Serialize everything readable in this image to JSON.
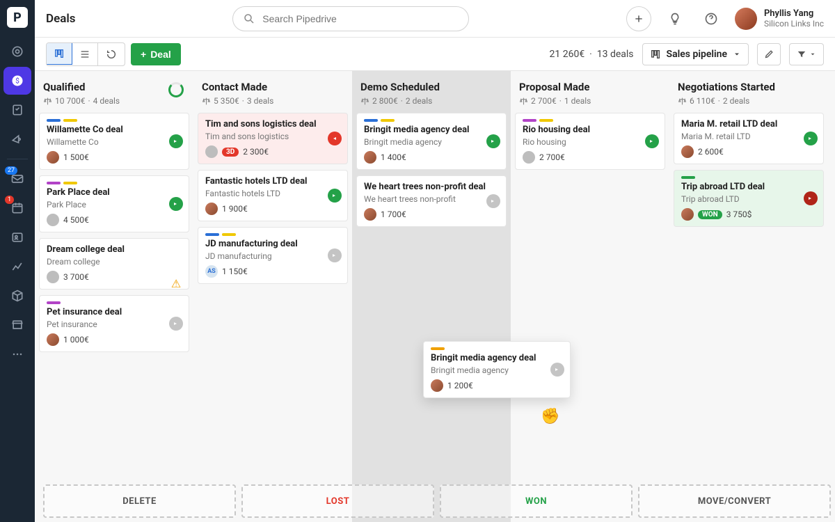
{
  "page_title": "Deals",
  "search_placeholder": "Search Pipedrive",
  "user": {
    "name": "Phyllis Yang",
    "org": "Silicon Links Inc"
  },
  "nav_badges": {
    "mail": "27",
    "calendar": "1"
  },
  "toolbar": {
    "deal_btn": "Deal",
    "summary_value": "21 260€",
    "summary_count": "13 deals",
    "pipeline_label": "Sales pipeline"
  },
  "columns": [
    {
      "title": "Qualified",
      "value": "10 700€",
      "count": "4 deals",
      "ring": true,
      "cards": [
        {
          "stripes": [
            "#2a6fd6",
            "#f0c800"
          ],
          "title": "Willamette Co deal",
          "org": "Willamette Co",
          "amount": "1 500€",
          "status": "green",
          "avatar": "photo"
        },
        {
          "stripes": [
            "#b243c7",
            "#f0c800"
          ],
          "title": "Park Place deal",
          "org": "Park Place",
          "amount": "4 500€",
          "status": "green",
          "avatar": "grey"
        },
        {
          "stripes": [],
          "title": "Dream college deal",
          "org": "Dream college",
          "amount": "3 700€",
          "status": "warn",
          "avatar": "grey"
        },
        {
          "stripes": [
            "#b243c7"
          ],
          "title": "Pet insurance deal",
          "org": "Pet insurance",
          "amount": "1 000€",
          "status": "grey",
          "avatar": "photo"
        }
      ]
    },
    {
      "title": "Contact Made",
      "value": "5 350€",
      "count": "3 deals",
      "cards": [
        {
          "stripes": [],
          "title": "Tim and sons logistics deal",
          "org": "Tim and sons logistics",
          "amount": "2 300€",
          "status": "red",
          "avatar": "grey",
          "pill": "3D",
          "bg": "red"
        },
        {
          "stripes": [],
          "title": "Fantastic hotels LTD deal",
          "org": "Fantastic hotels LTD",
          "amount": "1 900€",
          "status": "green",
          "avatar": "photo"
        },
        {
          "stripes": [
            "#2a6fd6",
            "#f0c800"
          ],
          "title": "JD manufacturing deal",
          "org": "JD manufacturing",
          "amount": "1 150€",
          "status": "grey",
          "avatar": "initials",
          "initials": "AS"
        }
      ]
    },
    {
      "title": "Demo Scheduled",
      "value": "2 800€",
      "count": "2 deals",
      "dragging": true,
      "cards": [
        {
          "stripes": [
            "#2a6fd6",
            "#f0c800"
          ],
          "title": "Bringit media agency deal",
          "org": "Bringit media agency",
          "amount": "1 400€",
          "status": "green",
          "avatar": "photo"
        },
        {
          "stripes": [],
          "title": "We heart trees non-profit deal",
          "org": "We heart trees non-profit",
          "amount": "1 700€",
          "status": "grey",
          "avatar": "photo"
        }
      ]
    },
    {
      "title": "Proposal Made",
      "value": "2 700€",
      "count": "1 deals",
      "cards": [
        {
          "stripes": [
            "#b243c7",
            "#f0c800"
          ],
          "title": "Rio housing deal",
          "org": "Rio housing",
          "amount": "2 700€",
          "status": "green",
          "avatar": "grey"
        }
      ]
    },
    {
      "title": "Negotiations Started",
      "value": "6 110€",
      "count": "2 deals",
      "cards": [
        {
          "stripes": [],
          "title": "Maria M. retail LTD deal",
          "org": "Maria M. retail LTD",
          "amount": "2 600€",
          "status": "green",
          "avatar": "photo"
        },
        {
          "stripes": [
            "#24a148"
          ],
          "title": "Trip abroad LTD deal",
          "org": "Trip abroad LTD",
          "amount": "3 750$",
          "status": "darkred",
          "avatar": "photo",
          "pill": "WON",
          "pillClass": "won",
          "bg": "green"
        }
      ]
    }
  ],
  "dragging_card": {
    "stripes": [
      "#f0a000"
    ],
    "title": "Bringit media agency deal",
    "org": "Bringit media agency",
    "amount": "1 200€",
    "status": "grey",
    "avatar": "photo"
  },
  "dropzones": [
    "DELETE",
    "LOST",
    "WON",
    "MOVE/CONVERT"
  ]
}
